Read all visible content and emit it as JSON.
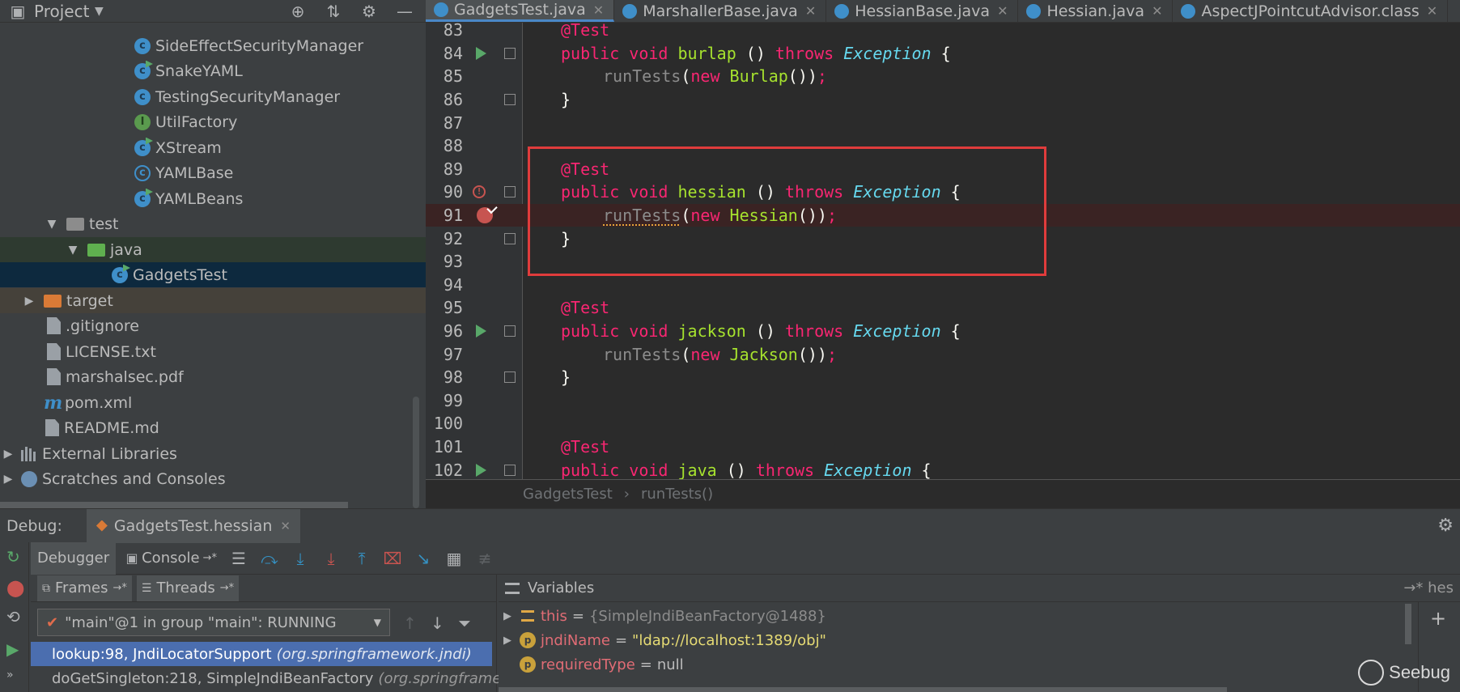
{
  "project": {
    "title": "Project",
    "tree": [
      {
        "label": "SideEffectSecurityManager",
        "icon": "class-icon"
      },
      {
        "label": "SnakeYAML",
        "icon": "class-run-icon"
      },
      {
        "label": "TestingSecurityManager",
        "icon": "class-icon"
      },
      {
        "label": "UtilFactory",
        "icon": "interface-icon"
      },
      {
        "label": "XStream",
        "icon": "class-run-icon"
      },
      {
        "label": "YAMLBase",
        "icon": "abstract-class-icon"
      },
      {
        "label": "YAMLBeans",
        "icon": "class-run-icon"
      },
      {
        "label": "test",
        "icon": "folder-icon"
      },
      {
        "label": "java",
        "icon": "test-folder-icon"
      },
      {
        "label": "GadgetsTest",
        "icon": "test-class-icon"
      },
      {
        "label": "target",
        "icon": "excluded-folder-icon"
      },
      {
        "label": ".gitignore",
        "icon": "file-icon"
      },
      {
        "label": "LICENSE.txt",
        "icon": "file-icon"
      },
      {
        "label": "marshalsec.pdf",
        "icon": "file-icon"
      },
      {
        "label": "pom.xml",
        "icon": "maven-icon"
      },
      {
        "label": "README.md",
        "icon": "markdown-icon"
      },
      {
        "label": "External Libraries",
        "icon": "library-icon"
      },
      {
        "label": "Scratches and Consoles",
        "icon": "scratches-icon"
      }
    ]
  },
  "editor": {
    "tabs": [
      {
        "label": "GadgetsTest.java",
        "active": true
      },
      {
        "label": "MarshallerBase.java",
        "active": false
      },
      {
        "label": "HessianBase.java",
        "active": false
      },
      {
        "label": "Hessian.java",
        "active": false
      },
      {
        "label": "AspectJPointcutAdvisor.class",
        "active": false
      }
    ],
    "lines": [
      {
        "n": "83",
        "text": "@Test"
      },
      {
        "n": "84",
        "text": "public void burlap () throws Exception {"
      },
      {
        "n": "85",
        "text": "runTests(new Burlap());"
      },
      {
        "n": "86",
        "text": "}"
      },
      {
        "n": "87",
        "text": ""
      },
      {
        "n": "88",
        "text": ""
      },
      {
        "n": "89",
        "text": "@Test"
      },
      {
        "n": "90",
        "text": "public void hessian () throws Exception {"
      },
      {
        "n": "91",
        "text": "runTests(new Hessian());"
      },
      {
        "n": "92",
        "text": "}"
      },
      {
        "n": "93",
        "text": ""
      },
      {
        "n": "94",
        "text": ""
      },
      {
        "n": "95",
        "text": "@Test"
      },
      {
        "n": "96",
        "text": "public void jackson () throws Exception {"
      },
      {
        "n": "97",
        "text": "runTests(new Jackson());"
      },
      {
        "n": "98",
        "text": "}"
      },
      {
        "n": "99",
        "text": ""
      },
      {
        "n": "100",
        "text": ""
      },
      {
        "n": "101",
        "text": "@Test"
      },
      {
        "n": "102",
        "text": "public void java () throws Exception {"
      }
    ],
    "breadcrumb": [
      "GadgetsTest",
      "runTests()"
    ],
    "breadcrumb_sep": "›"
  },
  "debug": {
    "label": "Debug:",
    "session": "GadgetsTest.hessian",
    "tabs": {
      "debugger": "Debugger",
      "console": "Console"
    },
    "frames_tab": "Frames",
    "threads_tab": "Threads",
    "tab_suffix": "→*",
    "thread": "\"main\"@1 in group \"main\": RUNNING",
    "frames": [
      {
        "method": "lookup:98, JndiLocatorSupport",
        "pkg": "(org.springframework.jndi)"
      },
      {
        "method": "doGetSingleton:218, SimpleJndiBeanFactory",
        "pkg": "(org.springframew"
      }
    ],
    "variables_title": "Variables",
    "vars_right_label": "→* hes",
    "variables": [
      {
        "name": "this",
        "eq": "=",
        "value": "{SimpleJndiBeanFactory@1488}"
      },
      {
        "name": "jndiName",
        "eq": "=",
        "value": "\"ldap://localhost:1389/obj\""
      },
      {
        "name": "requiredType",
        "eq": "=",
        "value": "null"
      }
    ],
    "watermark": "Seebug"
  }
}
